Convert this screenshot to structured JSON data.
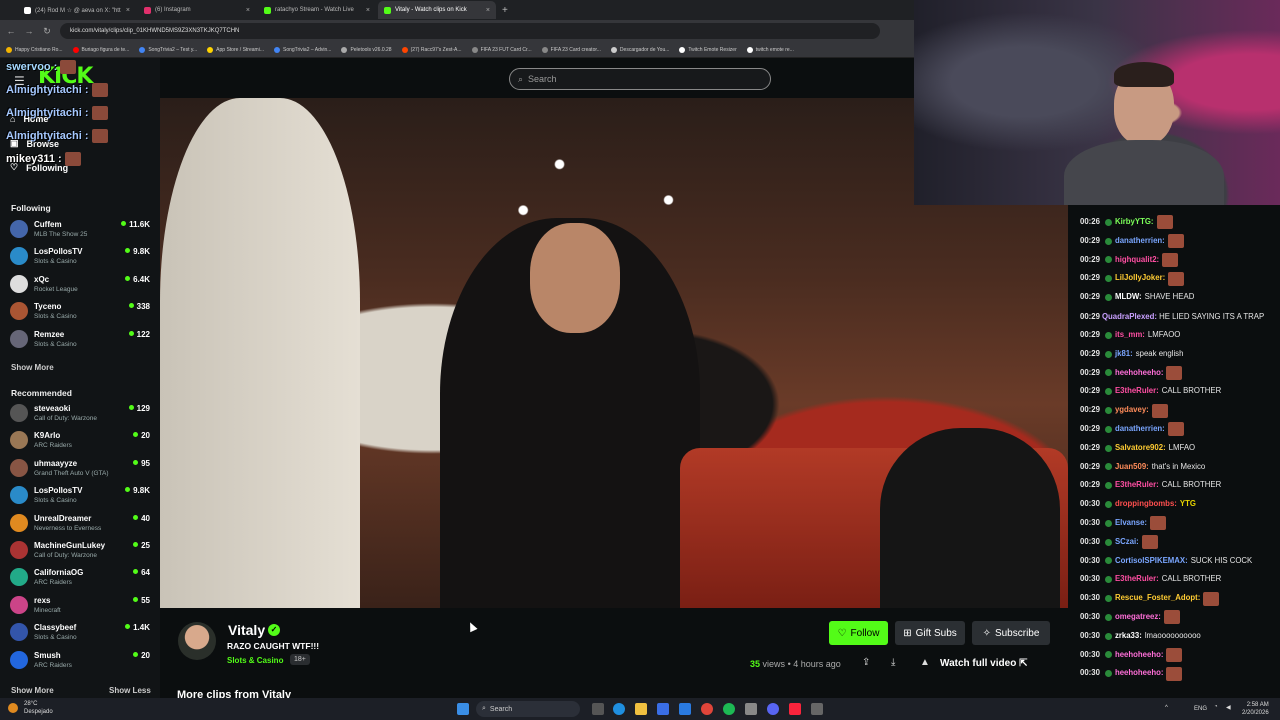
{
  "browser": {
    "tabs": [
      {
        "label": "(24) Rod M ☆ @ aeva on X: \"htt",
        "color": "#ffffff"
      },
      {
        "label": "(6) Instagram",
        "color": "#e1306c"
      },
      {
        "label": "ratachyo Stream - Watch Live",
        "color": "#53fc18"
      },
      {
        "label": "Vitaly - Watch clips on Kick",
        "color": "#53fc18"
      }
    ],
    "new_tab": "+",
    "url": "kick.com/vitaly/clips/clip_01KHWND5MS9Z3XN3TKJKQ7TCHN",
    "bookmarks": [
      {
        "label": "Happy Cristiano Ro...",
        "color": "#f4b400"
      },
      {
        "label": "Buriago figura de te...",
        "color": "#ff0000"
      },
      {
        "label": "SongTrivia2 – Test y...",
        "color": "#4285f4"
      },
      {
        "label": "App Store / Streami...",
        "color": "#ffd400"
      },
      {
        "label": "SongTrivia2 – Advin...",
        "color": "#4285f4"
      },
      {
        "label": "Peletools v26.0.28",
        "color": "#aaaaaa"
      },
      {
        "label": "(27) Racc97's Zest-A...",
        "color": "#ff4500"
      },
      {
        "label": "FIFA 23 FUT Card Cr...",
        "color": "#888888"
      },
      {
        "label": "FIFA 23 Card creator...",
        "color": "#888888"
      },
      {
        "label": "Descargador de You...",
        "color": "#cccccc"
      },
      {
        "label": "Twitch Emote Resizer",
        "color": "#ffffff"
      },
      {
        "label": "twitch emote re...",
        "color": "#ffffff"
      }
    ]
  },
  "site": {
    "logo": "KICK",
    "search_placeholder": "Search",
    "nav": {
      "home": "Home",
      "browse": "Browse",
      "following": "Following"
    },
    "following_header": "Following",
    "following": [
      {
        "name": "Cuffem",
        "category": "MLB The Show 25",
        "viewers": "11.6K",
        "color": "#4466aa"
      },
      {
        "name": "LosPollosTV",
        "category": "Slots & Casino",
        "viewers": "9.8K",
        "color": "#2a8bc9"
      },
      {
        "name": "xQc",
        "category": "Rocket League",
        "viewers": "6.4K",
        "color": "#dddddd"
      },
      {
        "name": "Tyceno",
        "category": "Slots & Casino",
        "viewers": "338",
        "color": "#aa5533"
      },
      {
        "name": "Remzee",
        "category": "Slots & Casino",
        "viewers": "122",
        "color": "#666677"
      }
    ],
    "show_more": "Show More",
    "recommended_header": "Recommended",
    "recommended": [
      {
        "name": "steveaoki",
        "category": "Call of Duty: Warzone",
        "viewers": "129",
        "color": "#555555"
      },
      {
        "name": "K9Arlo",
        "category": "ARC Raiders",
        "viewers": "20",
        "color": "#997755"
      },
      {
        "name": "uhmaayyze",
        "category": "Grand Theft Auto V (GTA)",
        "viewers": "95",
        "color": "#885544"
      },
      {
        "name": "LosPollosTV",
        "category": "Slots & Casino",
        "viewers": "9.8K",
        "color": "#2a8bc9"
      },
      {
        "name": "UnrealDreamer",
        "category": "Neverness to Everness",
        "viewers": "40",
        "color": "#e08a20"
      },
      {
        "name": "MachineGunLukey",
        "category": "Call of Duty: Warzone",
        "viewers": "25",
        "color": "#aa3333"
      },
      {
        "name": "CaliforniaOG",
        "category": "ARC Raiders",
        "viewers": "64",
        "color": "#22aa88"
      },
      {
        "name": "rexs",
        "category": "Minecraft",
        "viewers": "55",
        "color": "#cc4488"
      },
      {
        "name": "Classybeef",
        "category": "Slots & Casino",
        "viewers": "1.4K",
        "color": "#3355aa"
      },
      {
        "name": "Smush",
        "category": "ARC Raiders",
        "viewers": "20",
        "color": "#2266dd"
      }
    ],
    "show_more_2": "Show More",
    "show_less": "Show Less"
  },
  "overlay_chat": [
    {
      "user": "swervoo :",
      "color": "#a5d8ff"
    },
    {
      "user": "Almightyitachi :",
      "color": "#a5c8ff"
    },
    {
      "user": "Almightyitachi :",
      "color": "#a5c8ff"
    },
    {
      "user": "Almightyitachi :",
      "color": "#a5c8ff"
    },
    {
      "user": "mikey311 :",
      "color": "#ffffff"
    }
  ],
  "clip": {
    "streamer": "Vitaly",
    "verified": "✓",
    "title": "RAZO CAUGHT WTF!!!",
    "category": "Slots & Casino",
    "age_rating": "18+",
    "follow": "Follow",
    "gift_subs": "Gift Subs",
    "subscribe": "Subscribe",
    "views": "35",
    "views_label": "views",
    "time_ago": "• 4 hours ago",
    "watch_full": "Watch full video",
    "more_clips": "More clips from Vitaly"
  },
  "chat": [
    {
      "time": "00:26",
      "user": "KirbyYTG:",
      "color": "#7cff5a",
      "text": "",
      "emote": true
    },
    {
      "time": "00:29",
      "user": "danatherrien:",
      "color": "#7aa6ff",
      "text": "",
      "emote": true
    },
    {
      "time": "00:29",
      "user": "highqualit2:",
      "color": "#ff4fa3",
      "text": "",
      "emote": true
    },
    {
      "time": "00:29",
      "user": "LilJollyJoker:",
      "color": "#ffcc33",
      "text": "",
      "emote": true
    },
    {
      "time": "00:29",
      "user": "MLDW:",
      "color": "#ffffff",
      "text": "SHAVE HEAD",
      "emote": false
    },
    {
      "time": "00:29",
      "user": "QuadraPlexed:",
      "color": "#c9a0ff",
      "text": "HE LIED SAYING ITS A TRAP",
      "emote": false,
      "wrap": true
    },
    {
      "time": "00:29",
      "user": "its_mm:",
      "color": "#ff4fa3",
      "text": "LMFAOO",
      "emote": false
    },
    {
      "time": "00:29",
      "user": "jk81:",
      "color": "#7aa6ff",
      "text": "speak english",
      "emote": false
    },
    {
      "time": "00:29",
      "user": "heehoheeho:",
      "color": "#ff6fd8",
      "text": "",
      "emote": true
    },
    {
      "time": "00:29",
      "user": "E3theRuler:",
      "color": "#ff4fa3",
      "text": "CALL BROTHER",
      "emote": false
    },
    {
      "time": "00:29",
      "user": "ygdavey:",
      "color": "#ff8c5a",
      "text": "",
      "emote": true
    },
    {
      "time": "00:29",
      "user": "danatherrien:",
      "color": "#7aa6ff",
      "text": "",
      "emote": true
    },
    {
      "time": "00:29",
      "user": "Salvatore902:",
      "color": "#ffcc33",
      "text": "LMFAO",
      "emote": false
    },
    {
      "time": "00:29",
      "user": "Juan509:",
      "color": "#ff8c5a",
      "text": "that's in Mexico",
      "emote": false
    },
    {
      "time": "00:29",
      "user": "E3theRuler:",
      "color": "#ff4fa3",
      "text": "CALL BROTHER",
      "emote": false
    },
    {
      "time": "00:30",
      "user": "droppingbombs:",
      "color": "#ff4f4f",
      "text": "YTG",
      "emote": false
    },
    {
      "time": "00:30",
      "user": "Elvanse:",
      "color": "#7aa6ff",
      "text": "",
      "emote": true
    },
    {
      "time": "00:30",
      "user": "SCzai:",
      "color": "#7aa6ff",
      "text": "",
      "emote": true
    },
    {
      "time": "00:30",
      "user": "CortisolSPIKEMAX:",
      "color": "#7aa6ff",
      "text": "SUCK HIS COCK",
      "emote": false
    },
    {
      "time": "00:30",
      "user": "E3theRuler:",
      "color": "#ff4fa3",
      "text": "CALL BROTHER",
      "emote": false
    },
    {
      "time": "00:30",
      "user": "Rescue_Foster_Adopt:",
      "color": "#ffcc33",
      "text": "",
      "emote": true
    },
    {
      "time": "00:30",
      "user": "omegatreez:",
      "color": "#ff6fd8",
      "text": "",
      "emote": true
    },
    {
      "time": "00:30",
      "user": "zrka33:",
      "color": "#ffffff",
      "text": "lmaoooooooooo",
      "emote": false
    },
    {
      "time": "00:30",
      "user": "heehoheeho:",
      "color": "#ff6fd8",
      "text": "",
      "emote": true
    },
    {
      "time": "00:30",
      "user": "heehoheeho:",
      "color": "#ff6fd8",
      "text": "",
      "emote": true
    }
  ],
  "taskbar": {
    "weather_temp": "28°C",
    "weather_desc": "Despejado",
    "search": "Search",
    "lang": "ENG",
    "time": "2:58 AM",
    "date": "2/20/2026"
  }
}
